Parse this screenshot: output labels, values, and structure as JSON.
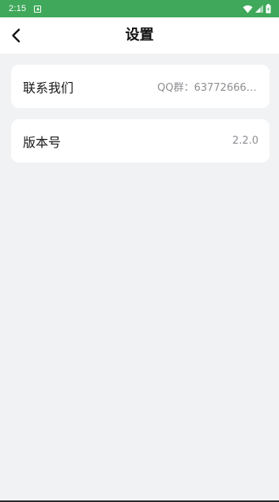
{
  "status_bar": {
    "time": "2:15",
    "background_color": "#3fa85a"
  },
  "header": {
    "title": "设置",
    "back_icon": "chevron-left-icon"
  },
  "settings": {
    "contact": {
      "label": "联系我们",
      "value": "QQ群：637726665 ..."
    },
    "version": {
      "label": "版本号",
      "value": "2.2.0"
    }
  },
  "colors": {
    "page_background": "#f1f2f4",
    "card_background": "#ffffff",
    "value_text": "#8e8e93"
  }
}
